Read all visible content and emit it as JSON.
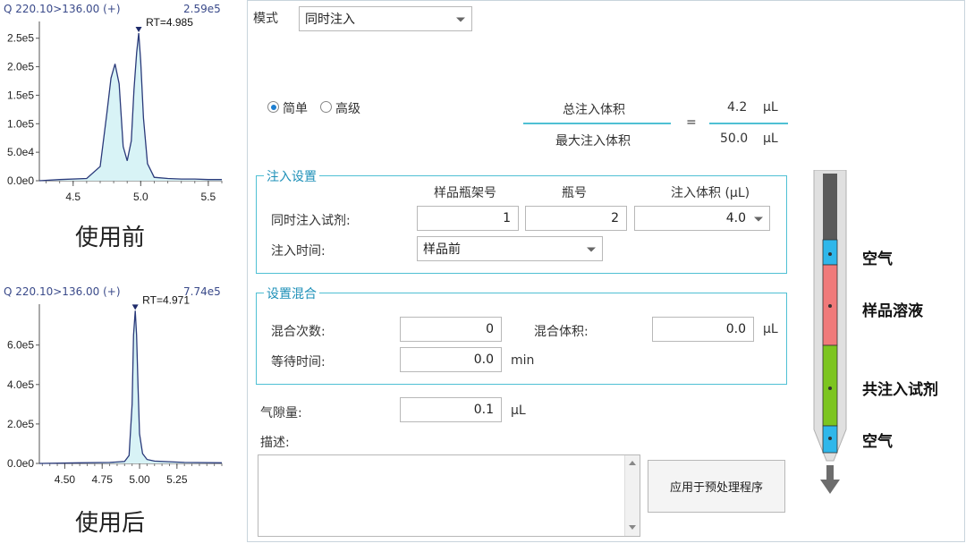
{
  "chart_data": [
    {
      "type": "line",
      "header_left": "Q 220.10>136.00 (+)",
      "header_right": "2.59e5",
      "peak_label": "RT=4.985",
      "x_ticks": [
        "4.5",
        "5.0",
        "5.5"
      ],
      "y_ticks": [
        "0.0e0",
        "5.0e4",
        "1.0e5",
        "1.5e5",
        "2.0e5",
        "2.5e5"
      ],
      "xlim": [
        4.25,
        5.6
      ],
      "ylim": [
        0,
        270000
      ],
      "x": [
        4.25,
        4.4,
        4.6,
        4.7,
        4.75,
        4.78,
        4.81,
        4.84,
        4.87,
        4.9,
        4.93,
        4.95,
        4.97,
        4.985,
        5.0,
        5.02,
        5.05,
        5.1,
        5.2,
        5.3,
        5.4,
        5.5,
        5.6
      ],
      "y": [
        0,
        2000,
        4000,
        25000,
        120000,
        180000,
        205000,
        170000,
        60000,
        35000,
        70000,
        160000,
        225000,
        259000,
        210000,
        110000,
        30000,
        6000,
        4000,
        3000,
        3000,
        2000,
        2000
      ],
      "caption": "使用前"
    },
    {
      "type": "line",
      "header_left": "Q 220.10>136.00 (+)",
      "header_right": "7.74e5",
      "peak_label": "RT=4.971",
      "x_ticks": [
        "4.50",
        "4.75",
        "5.00",
        "5.25"
      ],
      "y_ticks": [
        "0.0e0",
        "2.0e5",
        "4.0e5",
        "6.0e5"
      ],
      "xlim": [
        4.33,
        5.55
      ],
      "ylim": [
        0,
        780000
      ],
      "x": [
        4.33,
        4.6,
        4.8,
        4.9,
        4.93,
        4.95,
        4.96,
        4.971,
        4.98,
        4.99,
        5.0,
        5.02,
        5.05,
        5.1,
        5.3,
        5.55
      ],
      "y": [
        0,
        3000,
        5000,
        10000,
        40000,
        300000,
        650000,
        774000,
        650000,
        380000,
        150000,
        50000,
        20000,
        12000,
        5000,
        3000
      ],
      "caption": "使用后"
    }
  ],
  "form": {
    "mode_label": "模式",
    "mode_value": "同时注入",
    "radio_simple": "简单",
    "radio_advanced": "高级",
    "total_volume_label": "总注入体积",
    "max_volume_label": "最大注入体积",
    "equals": "=",
    "total_volume_value": "4.2",
    "max_volume_value": "50.0",
    "unit_ul": "μL",
    "inject_group_title": "注入设置",
    "col_rack": "样品瓶架号",
    "col_vial": "瓶号",
    "col_volume": "注入体积 (μL)",
    "co_inject_label": "同时注入试剂:",
    "rack_value": "1",
    "vial_value": "2",
    "volume_value": "4.0",
    "inject_time_label": "注入时间:",
    "inject_time_value": "样品前",
    "mix_group_title": "设置混合",
    "mix_count_label": "混合次数:",
    "mix_count_value": "0",
    "mix_volume_label": "混合体积:",
    "mix_volume_value": "0.0",
    "wait_time_label": "等待时间:",
    "wait_time_value": "0.0",
    "unit_min": "min",
    "air_gap_label": "气隙量:",
    "air_gap_value": "0.1",
    "description_label": "描述:",
    "apply_button": "应用于预处理程序"
  },
  "needle": {
    "air_top": "空气",
    "sample": "样品溶液",
    "reagent": "共注入试剂",
    "air_bottom": "空气",
    "colors": {
      "air": "#2fb7ea",
      "sample": "#f07a7a",
      "reagent": "#7cc51f",
      "barrel": "#5a5a5a"
    }
  }
}
